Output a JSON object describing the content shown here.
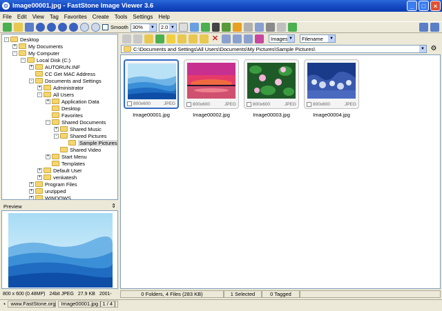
{
  "window": {
    "title": "Image00001.jpg - FastStone Image Viewer 3.6"
  },
  "menu": [
    "File",
    "Edit",
    "View",
    "Tag",
    "Favorites",
    "Create",
    "Tools",
    "Settings",
    "Help"
  ],
  "toolbar": {
    "smooth_label": "Smooth",
    "zoom_value": "30%",
    "ratio_value": "2.0"
  },
  "browser": {
    "filter_value": "Images",
    "sort_value": "Filename",
    "address": "C:\\Documents and Settings\\All Users\\Documents\\My Pictures\\Sample Pictures\\"
  },
  "tree": [
    {
      "label": "Desktop",
      "indent": 0,
      "pm": "-"
    },
    {
      "label": "My Documents",
      "indent": 1,
      "pm": "+"
    },
    {
      "label": "My Computer",
      "indent": 1,
      "pm": "-"
    },
    {
      "label": "Local Disk (C:)",
      "indent": 2,
      "pm": "-"
    },
    {
      "label": "AUTORUN.INF",
      "indent": 3,
      "pm": "+"
    },
    {
      "label": "CC Get MAC Address",
      "indent": 3,
      "pm": ""
    },
    {
      "label": "Documents and Settings",
      "indent": 3,
      "pm": "-"
    },
    {
      "label": "Administrator",
      "indent": 4,
      "pm": "+"
    },
    {
      "label": "All Users",
      "indent": 4,
      "pm": "-"
    },
    {
      "label": "Application Data",
      "indent": 5,
      "pm": "+"
    },
    {
      "label": "Desktop",
      "indent": 5,
      "pm": ""
    },
    {
      "label": "Favorites",
      "indent": 5,
      "pm": ""
    },
    {
      "label": "Shared Documents",
      "indent": 5,
      "pm": "-"
    },
    {
      "label": "Shared Music",
      "indent": 6,
      "pm": "+"
    },
    {
      "label": "Shared Pictures",
      "indent": 6,
      "pm": "-"
    },
    {
      "label": "Sample Pictures",
      "indent": 7,
      "pm": "",
      "selected": true
    },
    {
      "label": "Shared Video",
      "indent": 6,
      "pm": ""
    },
    {
      "label": "Start Menu",
      "indent": 5,
      "pm": "+"
    },
    {
      "label": "Templates",
      "indent": 5,
      "pm": ""
    },
    {
      "label": "Default User",
      "indent": 4,
      "pm": "+"
    },
    {
      "label": "venkatesh",
      "indent": 4,
      "pm": "+"
    },
    {
      "label": "Program Files",
      "indent": 3,
      "pm": "+"
    },
    {
      "label": "unzipped",
      "indent": 3,
      "pm": "+"
    },
    {
      "label": "WINDOWS",
      "indent": 3,
      "pm": "+"
    }
  ],
  "preview": {
    "title": "Preview",
    "info": [
      "800 x 600 (0.48MP)",
      "24bit JPEG",
      "27.9 KB",
      "2001-"
    ]
  },
  "thumbnails": [
    {
      "file": "Image00001.jpg",
      "dims": "800x600",
      "format": "JPEG",
      "selected": true,
      "style": "blue-hills"
    },
    {
      "file": "Image00002.jpg",
      "dims": "800x600",
      "format": "JPEG",
      "selected": false,
      "style": "sunset"
    },
    {
      "file": "Image00003.jpg",
      "dims": "800x600",
      "format": "JPEG",
      "selected": false,
      "style": "lilies"
    },
    {
      "file": "Image00004.jpg",
      "dims": "800x600",
      "format": "JPEG",
      "selected": false,
      "style": "winter"
    }
  ],
  "status": {
    "counts": "0 Folders, 4 Files (283 KB)",
    "selected": "1 Selected",
    "tagged": "0 Tagged"
  },
  "bottom": {
    "website": "www.FastStone.org",
    "file_info": "Image00001.jpg [ 1 / 4 ]"
  }
}
